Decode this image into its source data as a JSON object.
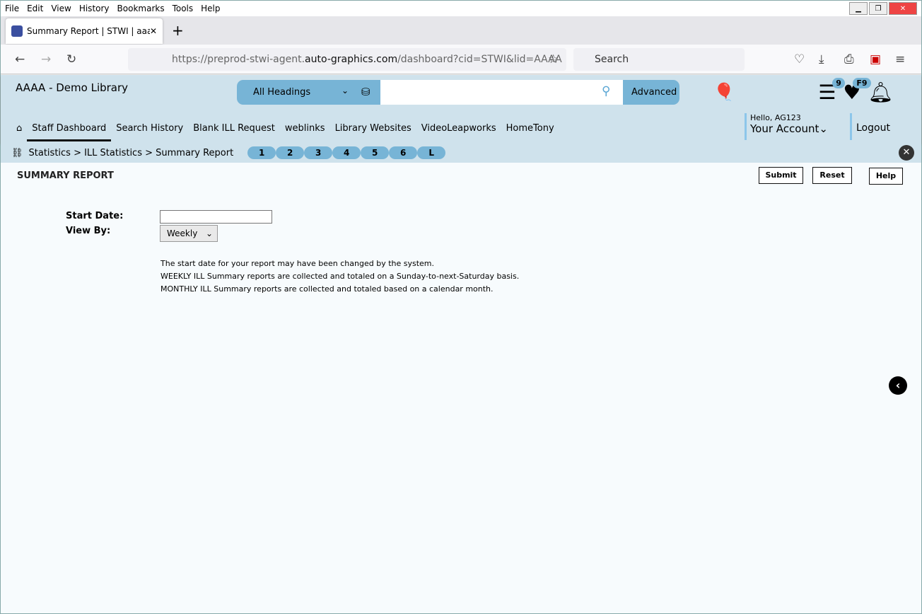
{
  "browser": {
    "menu": [
      "File",
      "Edit",
      "View",
      "History",
      "Bookmarks",
      "Tools",
      "Help"
    ],
    "tab_title": "Summary Report | STWI | aaaa |",
    "url_prefix": "https://preprod-stwi-agent.",
    "url_domain": "auto-graphics.com",
    "url_rest": "/dashboard?cid=STWI&lid=AAAA",
    "search_placeholder": "Search"
  },
  "header": {
    "library": "AAAA - Demo Library",
    "search_scope": "All Headings",
    "search_value": "",
    "advanced": "Advanced",
    "list_badge": "9",
    "fav_badge": "F9",
    "hello": "Hello, AG123",
    "account": "Your Account",
    "logout": "Logout"
  },
  "nav": [
    "Staff Dashboard",
    "Search History",
    "Blank ILL Request",
    "weblinks",
    "Library Websites",
    "VideoLeapworks",
    "HomeTony"
  ],
  "breadcrumb": "Statistics > ILL Statistics > Summary Report",
  "pills": [
    "1",
    "2",
    "3",
    "4",
    "5",
    "6",
    "L"
  ],
  "page": {
    "title": "SUMMARY REPORT",
    "submit": "Submit",
    "reset": "Reset",
    "help": "Help",
    "start_date_label": "Start Date:",
    "start_date": "",
    "view_by_label": "View By:",
    "view_by": "Weekly",
    "info": [
      "The start date for your report may have been changed by the system.",
      "WEEKLY ILL Summary reports are collected and totaled on a Sunday-to-next-Saturday basis.",
      "MONTHLY ILL Summary reports are collected and totaled based on a calendar month."
    ]
  }
}
